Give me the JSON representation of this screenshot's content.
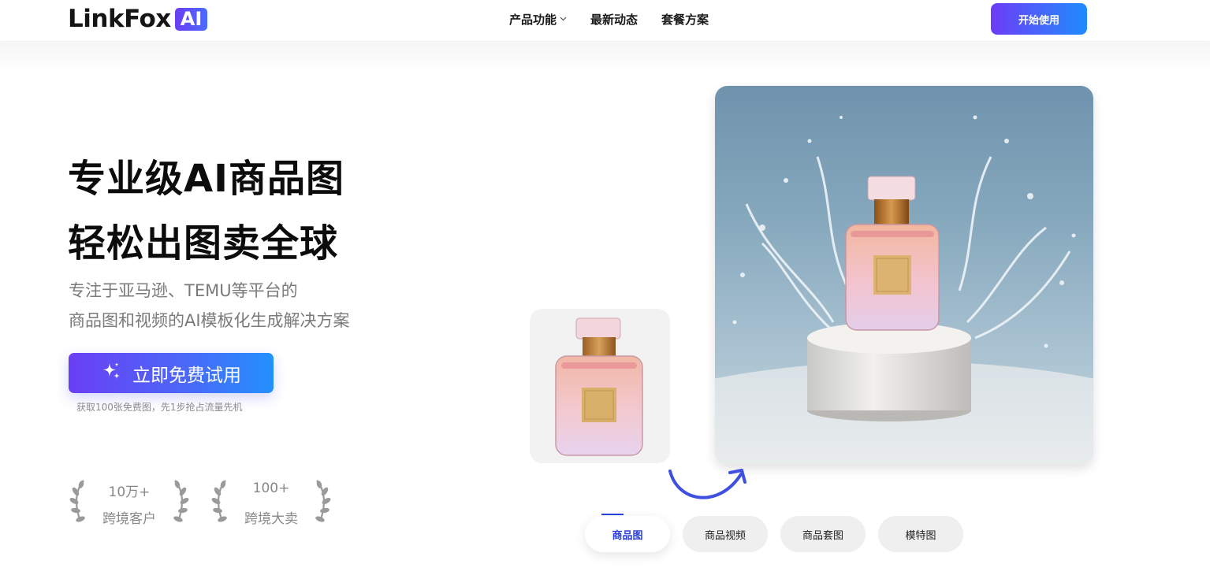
{
  "header": {
    "logo_text": "LinkFox",
    "logo_badge": "AI",
    "nav": [
      {
        "label": "产品功能",
        "has_dropdown": true
      },
      {
        "label": "最新动态",
        "has_dropdown": false
      },
      {
        "label": "套餐方案",
        "has_dropdown": false
      }
    ],
    "start_button": "开始使用"
  },
  "hero": {
    "title_line1": "专业级AI商品图",
    "title_line2": "轻松出图卖全球",
    "subtitle_line1": "专注于亚马逊、TEMU等平台的",
    "subtitle_line2": "商品图和视频的AI模板化生成解决方案",
    "cta_label": "立即免费试用",
    "cta_icon": "sparkle-icon",
    "cta_note": "获取100张免费图，先1步抢占流量先机"
  },
  "stats": [
    {
      "value": "10万+",
      "label": "跨境客户"
    },
    {
      "value": "100+",
      "label": "跨境大卖"
    }
  ],
  "showcase": {
    "source_image": "perfume-bottle-plain-background",
    "result_image": "perfume-bottle-water-splash-scene",
    "arrow_icon": "curved-arrow-icon"
  },
  "tabs": [
    {
      "label": "商品图",
      "active": true
    },
    {
      "label": "商品视频",
      "active": false
    },
    {
      "label": "商品套图",
      "active": false
    },
    {
      "label": "模特图",
      "active": false
    }
  ],
  "colors": {
    "brand_purple": "#6a3df5",
    "brand_blue": "#1f8cfd",
    "active_tab_text": "#2a3fd6"
  }
}
